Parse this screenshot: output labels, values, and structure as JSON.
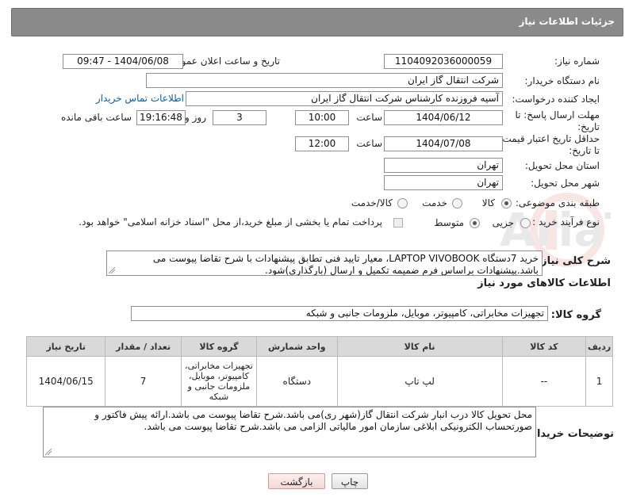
{
  "header": {
    "title": "جزئیات اطلاعات نیاز"
  },
  "fields": {
    "need_number_label": "شماره نیاز:",
    "need_number": "1104092036000059",
    "announce_label": "تاریخ و ساعت اعلان عمومی:",
    "announce_value": "1404/06/08 - 09:47",
    "buyer_label": "نام دستگاه خریدار:",
    "buyer_value": "شرکت انتقال گاز ایران",
    "creator_label": "ایجاد کننده درخواست:",
    "creator_value": "آسیه فروزنده کارشناس شرکت انتقال گاز ایران",
    "contact_link": "اطلاعات تماس خریدار",
    "deadline_label_1": "مهلت ارسال پاسخ: تا",
    "deadline_label_2": "تاریخ:",
    "deadline_date": "1404/06/12",
    "time_label": "ساعت",
    "deadline_time": "10:00",
    "days_value": "3",
    "days_label": "روز و",
    "remaining_time": "19:16:48",
    "remaining_label": "ساعت باقی مانده",
    "price_label_1": "حداقل تاریخ اعتبار قیمت:",
    "price_label_2": "تا تاریخ:",
    "price_date": "1404/07/08",
    "price_time": "12:00",
    "province_label": "استان محل تحویل:",
    "province_value": "تهران",
    "city_label": "شهر محل تحویل:",
    "city_value": "تهران",
    "category_label": "طبقه بندی موضوعی:",
    "cat_goods": "کالا",
    "cat_service": "خدمت",
    "cat_both": "کالا/خدمت",
    "process_label": "نوع فرآیند خرید :",
    "proc_small": "جزیی",
    "proc_medium": "متوسط",
    "proc_note": "پرداخت تمام یا بخشی از مبلغ خرید،از محل \"اسناد خزانه اسلامی\" خواهد بود.",
    "desc_label": "شرح کلی نیاز:",
    "desc_value": "خرید 7دستگاه LAPTOP VIVOBOOK، معیار تایید فنی تطابق پیشنهادات با شرح تقاضا پیوست می باشد.پیشنهادات براساس فرم ضمیمه تکمیل و ارسال (بارگذاری)شود.",
    "goods_info_title": "اطلاعات کالاهای مورد نیاز",
    "goods_group_label": "گروه کالا:",
    "goods_group_value": "تجهیزات مخابراتی، کامپیوتر، موبایل، ملزومات جانبی و شبکه",
    "buyer_notes_label": "توضیحات خریدار:",
    "buyer_notes_value": "محل تحویل کالا درب انبار شرکت انتقال گاز(شهر ری)می باشد.شرح تقاضا پیوست می باشد.ارائه پیش فاکتور و صورتحساب الکترونیکی ابلاغی سازمان امور مالیاتی الزامی می باشد.شرح تقاضا پیوست می باشد."
  },
  "table": {
    "headers": [
      "ردیف",
      "کد کالا",
      "نام کالا",
      "واحد شمارش",
      "گروه کالا",
      "تعداد / مقدار",
      "تاریخ نیاز"
    ],
    "rows": [
      [
        "1",
        "--",
        "لپ تاپ",
        "دستگاه",
        "تجهیزات مخابراتی، کامپیوتر، موبایل، ملزومات جانبی و شبکه",
        "7",
        "1404/06/15"
      ]
    ]
  },
  "buttons": {
    "print": "چاپ",
    "back": "بازگشت"
  },
  "watermark": {
    "text": "AriaTender.neT"
  }
}
